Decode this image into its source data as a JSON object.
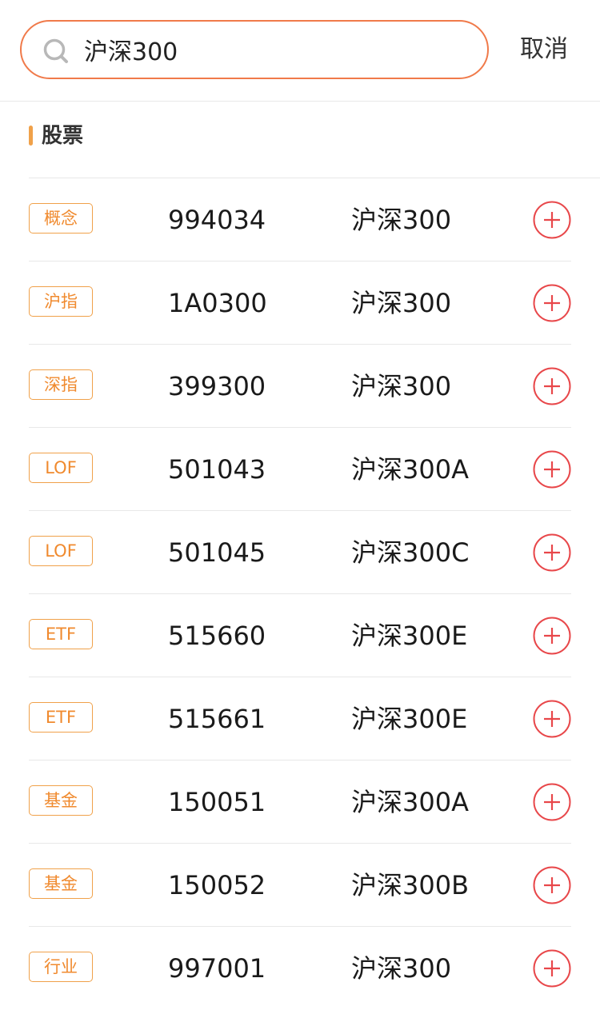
{
  "search": {
    "value": "沪深300",
    "cancel_label": "取消"
  },
  "section": {
    "title": "股票"
  },
  "colors": {
    "accent_orange": "#f07a4a",
    "tag_orange": "#f08a2e",
    "add_red": "#e8474a"
  },
  "results": [
    {
      "tag": "概念",
      "code": "994034",
      "name": "沪深300"
    },
    {
      "tag": "沪指",
      "code": "1A0300",
      "name": "沪深300"
    },
    {
      "tag": "深指",
      "code": "399300",
      "name": "沪深300"
    },
    {
      "tag": "LOF",
      "code": "501043",
      "name": "沪深300A"
    },
    {
      "tag": "LOF",
      "code": "501045",
      "name": "沪深300C"
    },
    {
      "tag": "ETF",
      "code": "515660",
      "name": "沪深300E"
    },
    {
      "tag": "ETF",
      "code": "515661",
      "name": "沪深300E"
    },
    {
      "tag": "基金",
      "code": "150051",
      "name": "沪深300A"
    },
    {
      "tag": "基金",
      "code": "150052",
      "name": "沪深300B"
    },
    {
      "tag": "行业",
      "code": "997001",
      "name": "沪深300"
    }
  ]
}
